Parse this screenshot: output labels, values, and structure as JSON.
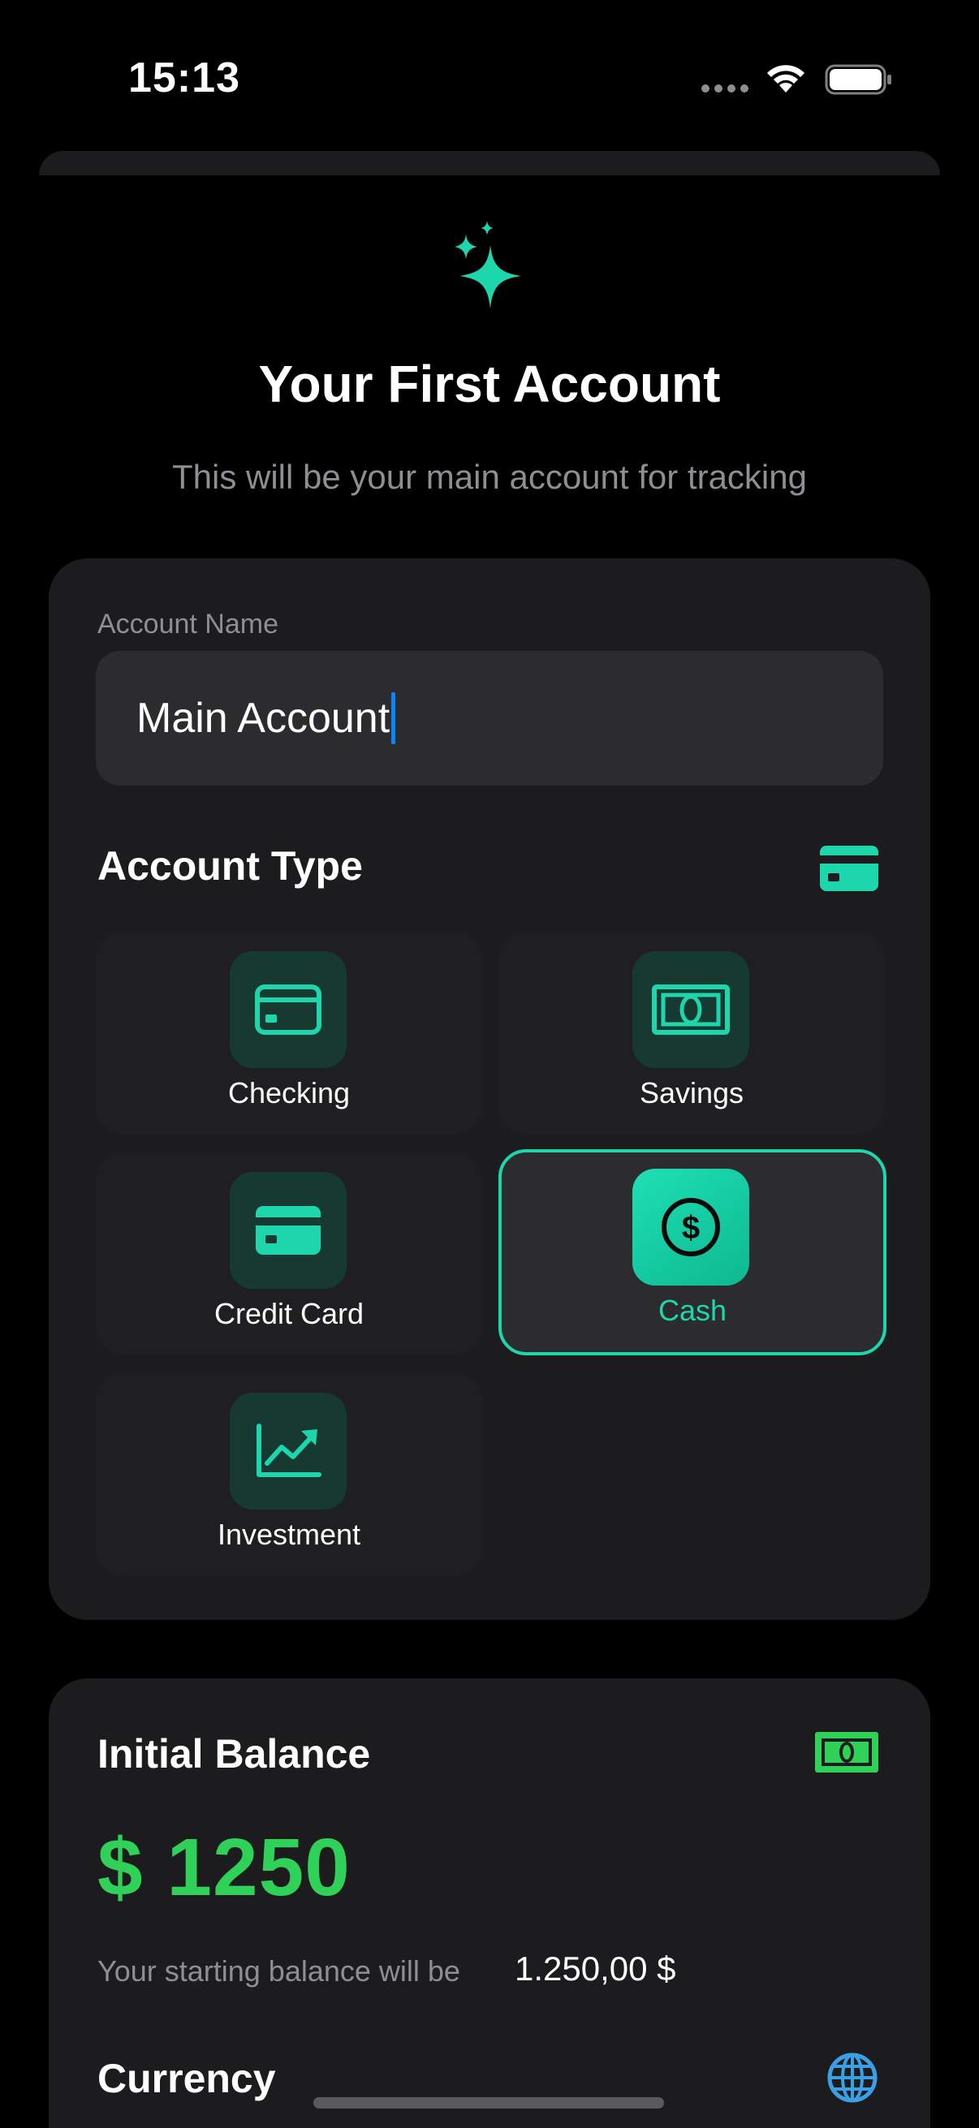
{
  "status_bar": {
    "time": "15:13"
  },
  "header": {
    "icon": "sparkles-icon",
    "title": "Your First Account",
    "subtitle": "This will be your main account for tracking"
  },
  "account_name": {
    "label": "Account Name",
    "value": "Main Account"
  },
  "account_type": {
    "title": "Account Type",
    "header_icon": "credit-card-icon",
    "selected": "Cash",
    "options": [
      {
        "label": "Checking",
        "icon": "card-outline-icon"
      },
      {
        "label": "Savings",
        "icon": "banknote-icon"
      },
      {
        "label": "Credit Card",
        "icon": "credit-card-icon"
      },
      {
        "label": "Cash",
        "icon": "dollar-circle-icon"
      },
      {
        "label": "Investment",
        "icon": "chart-trend-icon"
      }
    ]
  },
  "initial_balance": {
    "title": "Initial Balance",
    "header_icon": "banknote-icon",
    "amount": "$ 1250",
    "hint": "Your starting balance will be",
    "formatted": "1.250,00 $"
  },
  "currency": {
    "title": "Currency",
    "icon": "globe-icon"
  },
  "colors": {
    "accent": "#1ed6ac",
    "money_green": "#30d158",
    "card_bg": "#1c1c1e",
    "input_bg": "#2c2c2e"
  }
}
